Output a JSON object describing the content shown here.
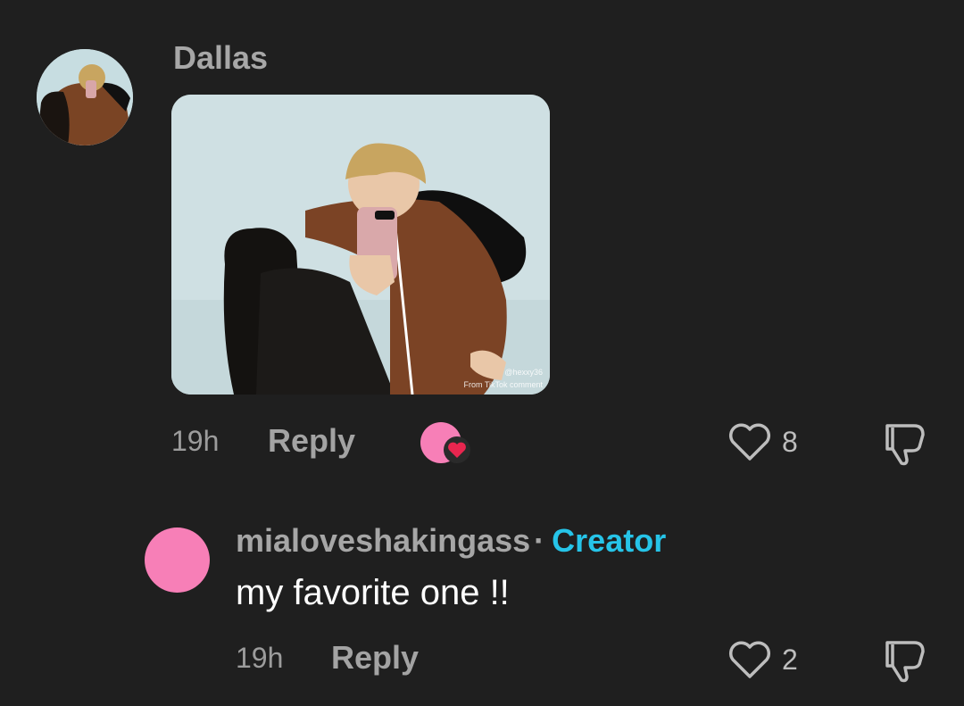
{
  "comment": {
    "username": "Dallas",
    "sticker": {
      "watermark_handle": "@hexxy36",
      "watermark_source": "From TikTok comment"
    },
    "time": "19h",
    "reply_label": "Reply",
    "likes": "8"
  },
  "reply": {
    "username": "mialoveshakingass",
    "separator": "·",
    "badge": "Creator",
    "text": "my favorite one !!",
    "time": "19h",
    "reply_label": "Reply",
    "likes": "2"
  },
  "colors": {
    "background": "#1f1f1f",
    "creator_badge": "#26c4e8",
    "avatar_pink": "#f77fb7",
    "heart_red": "#e8264f"
  },
  "icons": [
    "heart-outline-icon",
    "dislike-icon",
    "creator-liked-heart-icon"
  ]
}
